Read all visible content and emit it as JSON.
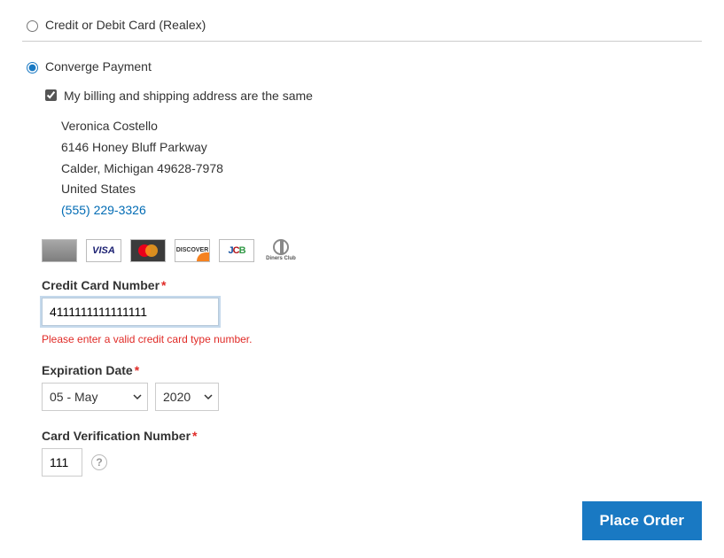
{
  "payment_methods": {
    "realex": {
      "label": "Credit or Debit Card (Realex)"
    },
    "converge": {
      "label": "Converge Payment"
    }
  },
  "same_address": {
    "label": "My billing and shipping address are the same"
  },
  "billing": {
    "name": "Veronica Costello",
    "street": "6146 Honey Bluff Parkway",
    "city_region_zip": "Calder, Michigan 49628-7978",
    "country": "United States",
    "phone": "(555) 229-3326"
  },
  "card_icons": {
    "visa_text": "VISA",
    "discover_text": "DISCOVER",
    "diners_text": "Diners Club"
  },
  "fields": {
    "cc_number": {
      "label": "Credit Card Number",
      "value": "4111111111111111",
      "error": "Please enter a valid credit card type number."
    },
    "exp": {
      "label": "Expiration Date",
      "month": "05 - May",
      "year": "2020"
    },
    "cvv": {
      "label": "Card Verification Number",
      "value": "111"
    }
  },
  "actions": {
    "place_order": "Place Order"
  }
}
